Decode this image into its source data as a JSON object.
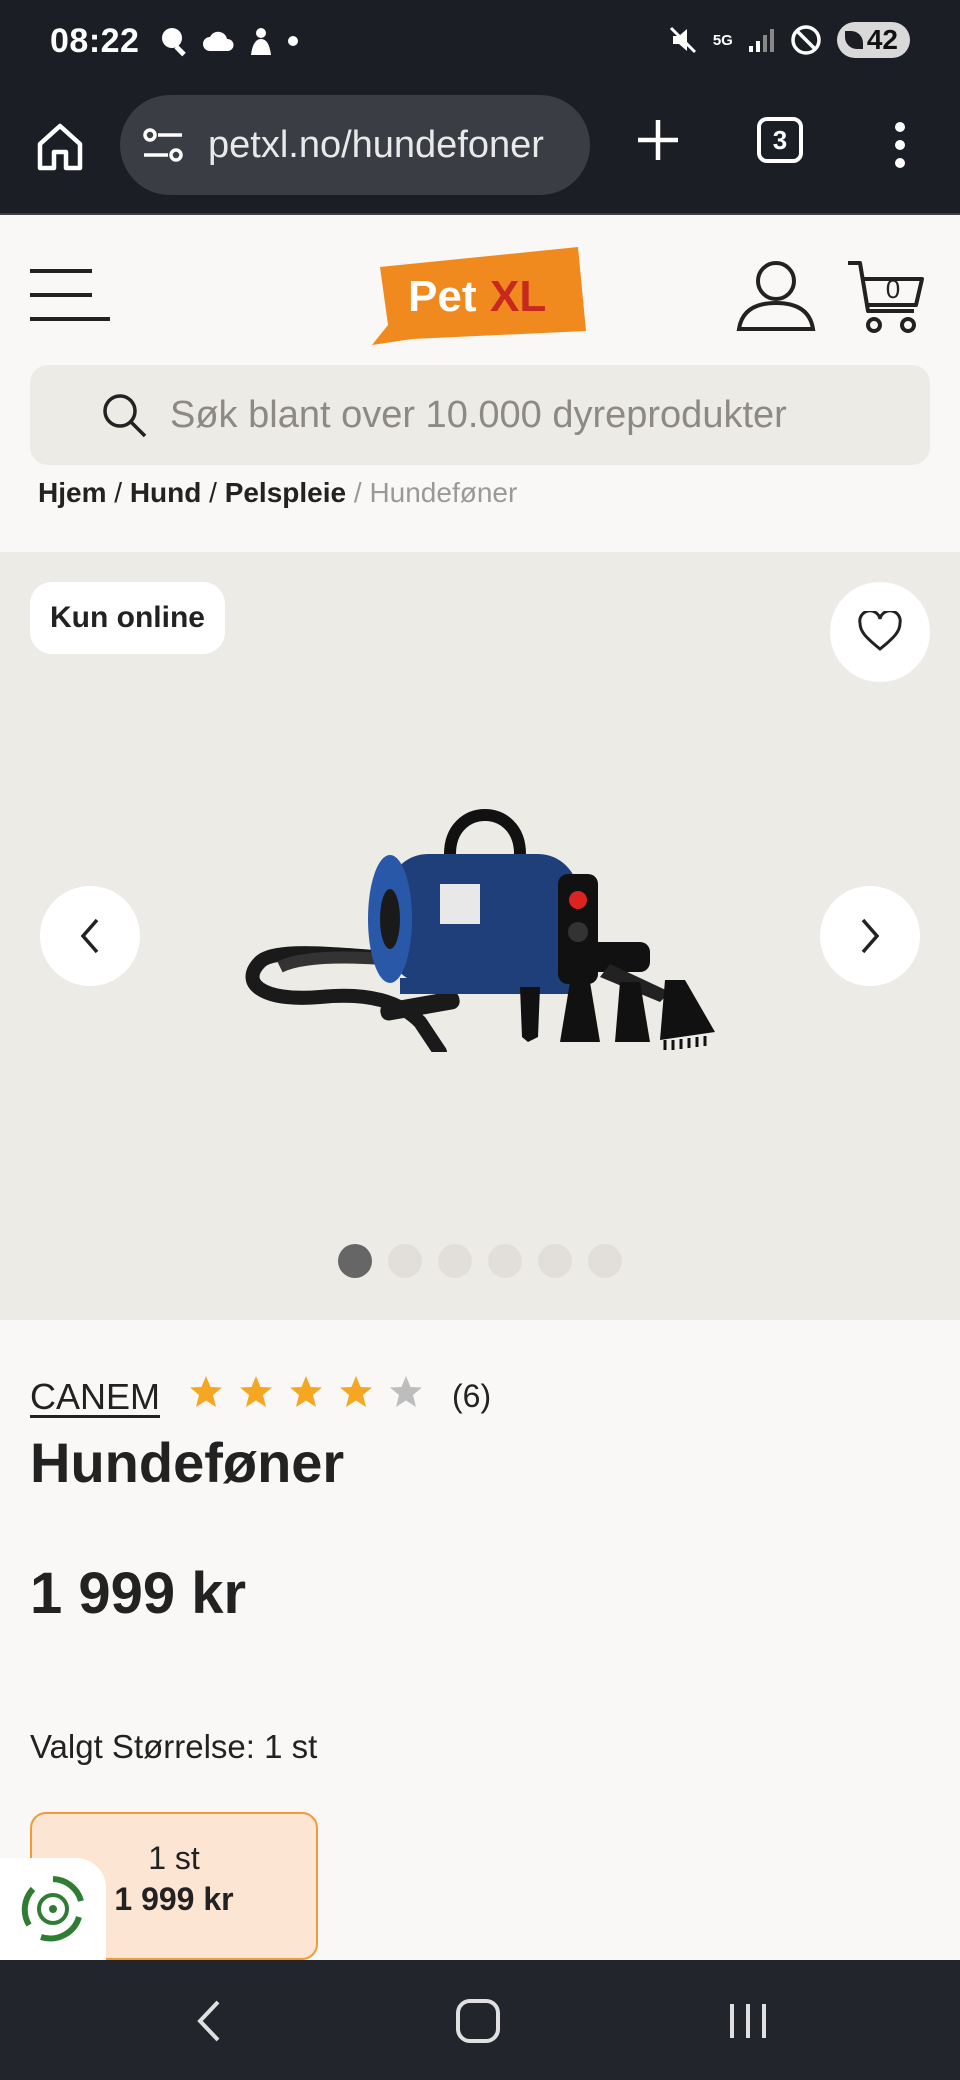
{
  "status_bar": {
    "time": "08:22",
    "network": "5G",
    "battery": "42"
  },
  "browser": {
    "url": "petxl.no/hundefoner",
    "tab_count": "3"
  },
  "header": {
    "logo_text_1": "Pet",
    "logo_text_2": "XL",
    "cart_count": "0",
    "search_placeholder": "Søk blant over 10.000 dyreprodukter",
    "breadcrumb": [
      "Hjem",
      "Hund",
      "Pelspleie",
      "Hundeføner"
    ]
  },
  "gallery": {
    "badge": "Kun online",
    "image_count": 6,
    "active_index": 0
  },
  "product": {
    "brand": "CANEM",
    "rating": 4,
    "rating_max": 5,
    "rating_count": "(6)",
    "title": "Hundeføner",
    "price": "1 999 kr",
    "variant_label": "Valgt Størrelse: 1 st",
    "variants": [
      {
        "size": "1 st",
        "price": "1 999 kr"
      }
    ]
  },
  "colors": {
    "brand_orange": "#f08a1f",
    "brand_red": "#c8281e",
    "star": "#f5a623",
    "star_empty": "#bdbdbd"
  }
}
